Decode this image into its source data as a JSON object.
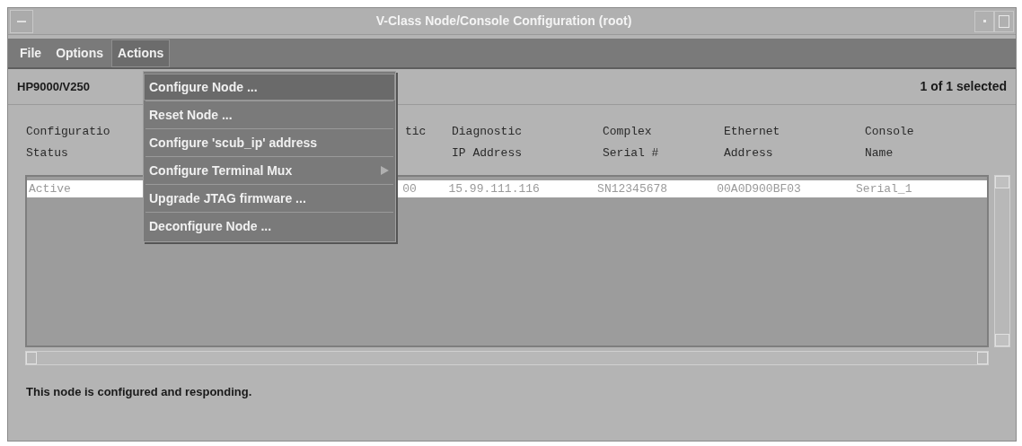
{
  "window": {
    "title": "V-Class Node/Console Configuration  (root)"
  },
  "menu_bar": [
    {
      "label": "File",
      "selected": false
    },
    {
      "label": "Options",
      "selected": false
    },
    {
      "label": "Actions",
      "selected": true
    }
  ],
  "actions_menu": [
    {
      "label": "Configure Node ...",
      "selected": true,
      "kind": "item"
    },
    {
      "label": "Reset Node ...",
      "selected": false,
      "kind": "item"
    },
    {
      "label": "Configure 'scub_ip' address",
      "selected": false,
      "kind": "item"
    },
    {
      "label": "Configure Terminal Mux",
      "selected": false,
      "kind": "submenu"
    },
    {
      "label": "Upgrade JTAG firmware ...",
      "selected": false,
      "kind": "item"
    },
    {
      "label": "Deconfigure Node ...",
      "selected": false,
      "kind": "item"
    }
  ],
  "node_label": "HP9000/V250",
  "selection_count": "1 of 1 selected",
  "table": {
    "columns": [
      "Configuratio\nStatus",
      "tic",
      "Diagnostic\nIP Address",
      "Complex\nSerial #",
      "Ethernet\nAddress",
      "Console\nName"
    ],
    "rows": [
      {
        "selected": true,
        "cells": [
          "Active",
          "00",
          "15.99.111.116",
          "SN12345678",
          "00A0D900BF03",
          "Serial_1"
        ]
      }
    ]
  },
  "status_message": "This node is configured and responding."
}
